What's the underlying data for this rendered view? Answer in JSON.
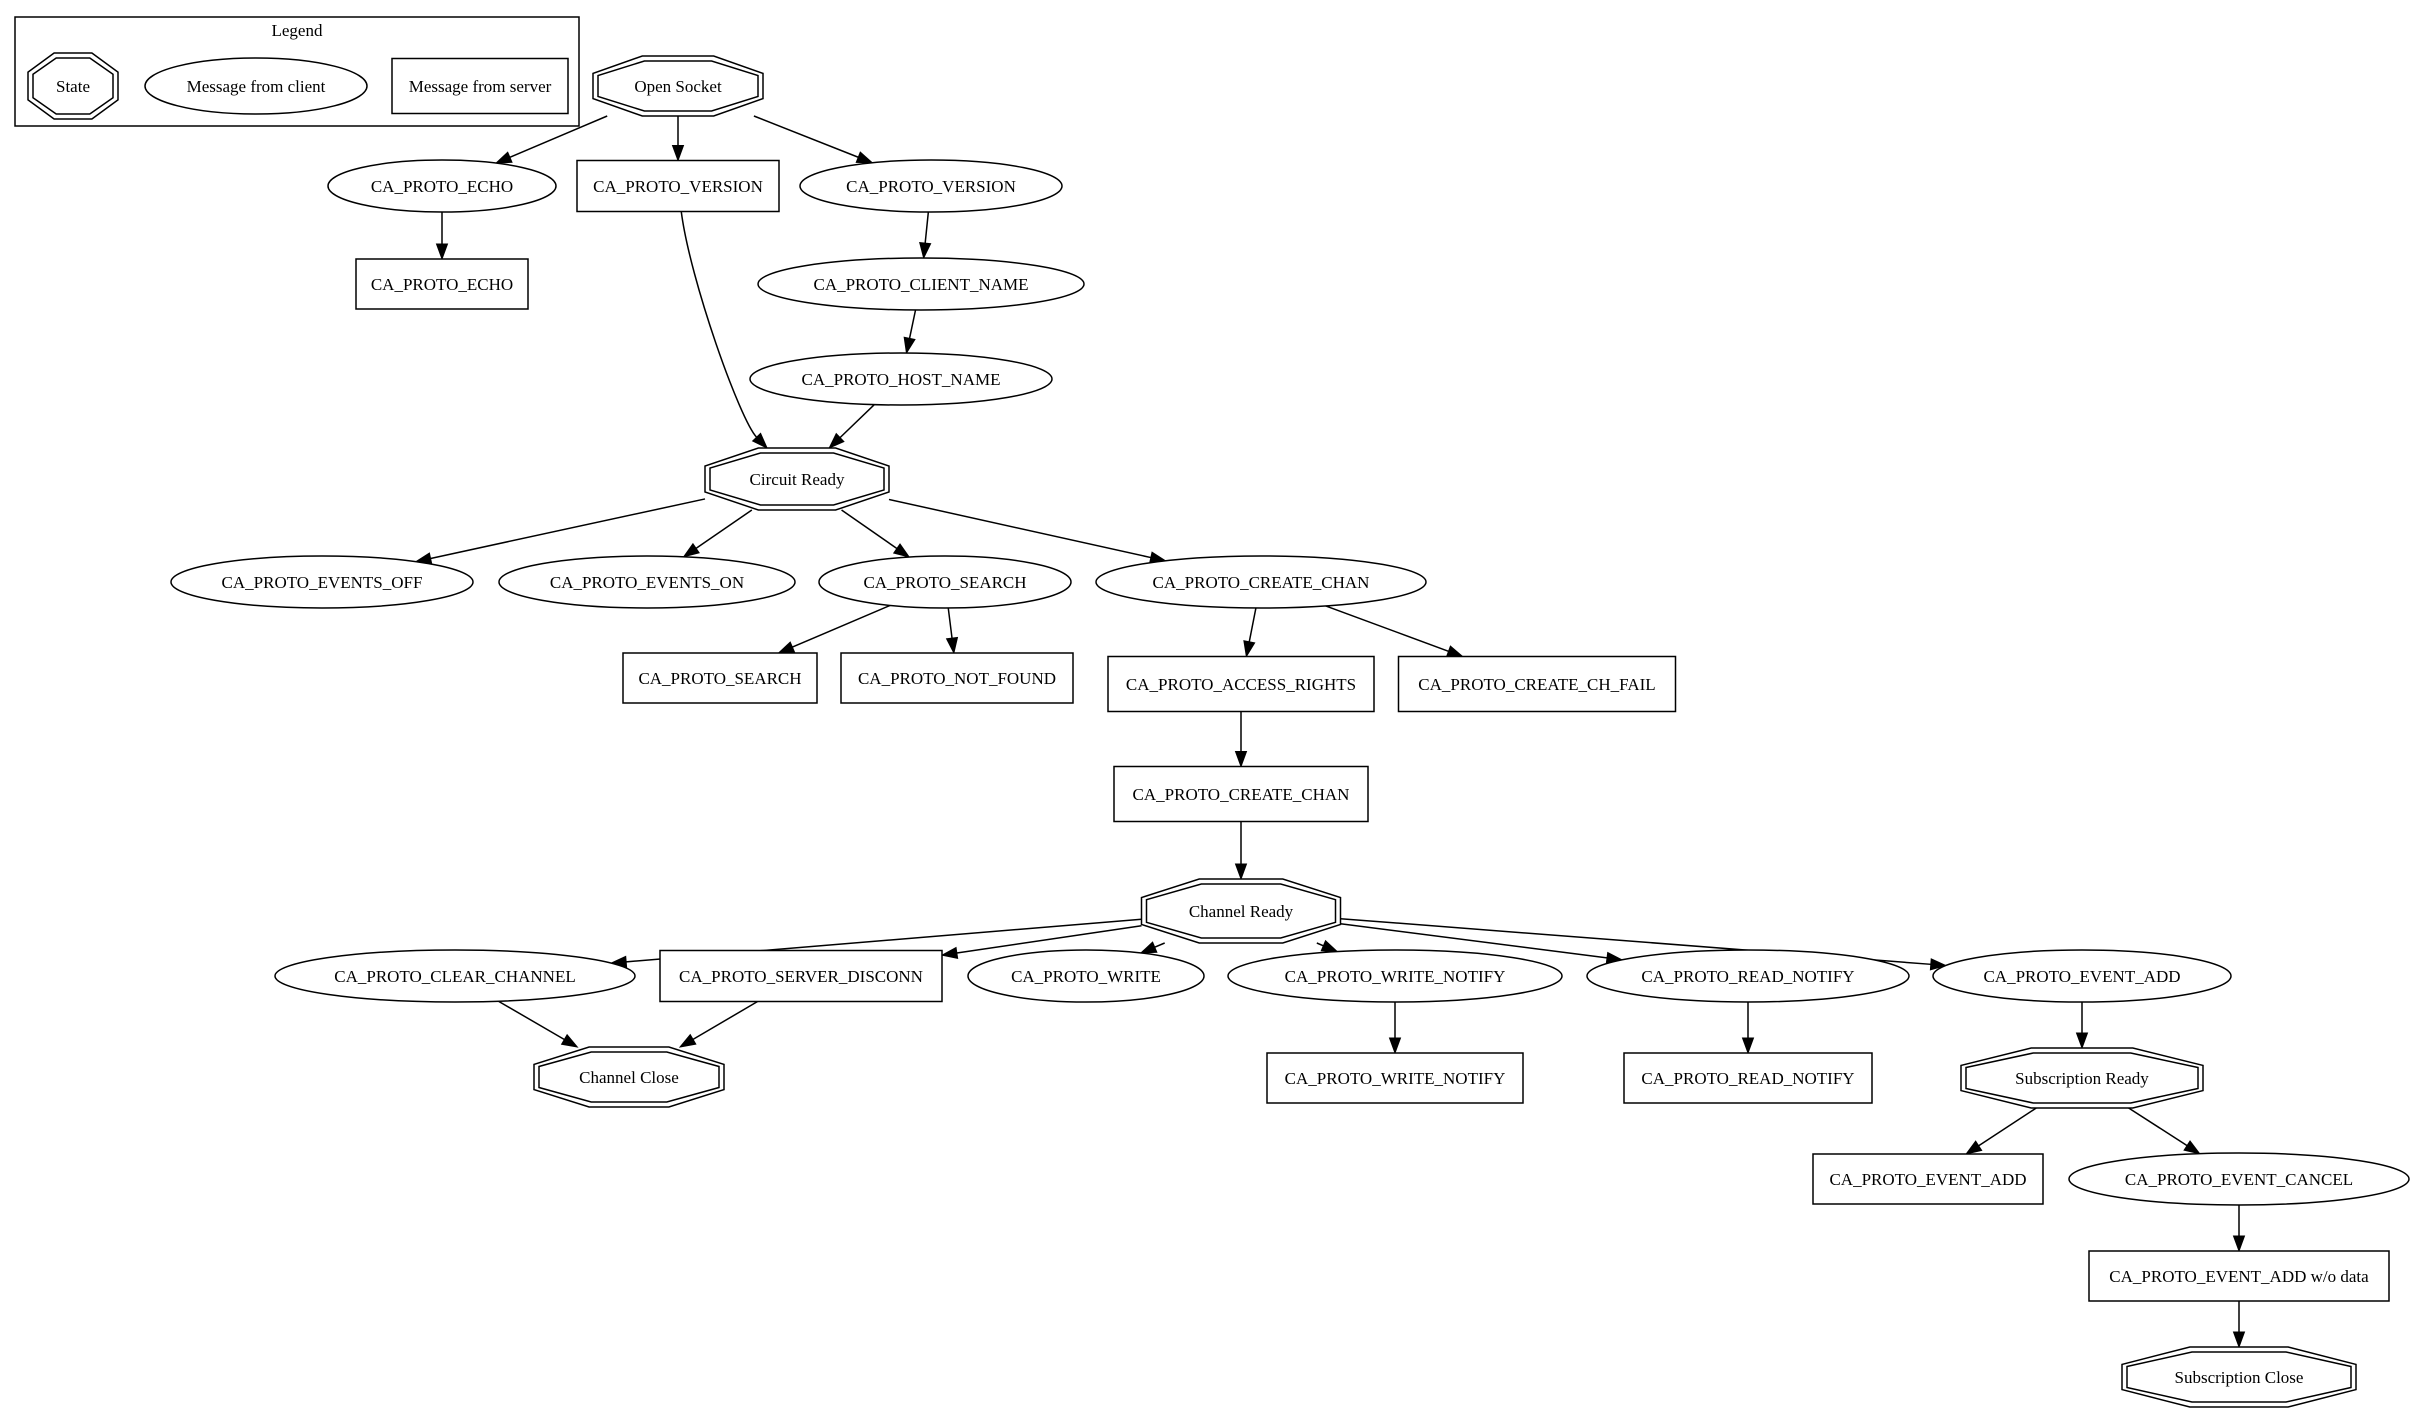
{
  "legend": {
    "title": "Legend",
    "items": [
      {
        "shape": "state",
        "label": "State"
      },
      {
        "shape": "client",
        "label": "Message from client"
      },
      {
        "shape": "server",
        "label": "Message from server"
      }
    ]
  },
  "nodes": {
    "open_socket": {
      "label": "Open Socket",
      "kind": "state"
    },
    "c_echo": {
      "label": "CA_PROTO_ECHO",
      "kind": "client"
    },
    "s_version": {
      "label": "CA_PROTO_VERSION",
      "kind": "server"
    },
    "c_version": {
      "label": "CA_PROTO_VERSION",
      "kind": "client"
    },
    "s_echo": {
      "label": "CA_PROTO_ECHO",
      "kind": "server"
    },
    "c_client_name": {
      "label": "CA_PROTO_CLIENT_NAME",
      "kind": "client"
    },
    "c_host_name": {
      "label": "CA_PROTO_HOST_NAME",
      "kind": "client"
    },
    "circuit_ready": {
      "label": "Circuit Ready",
      "kind": "state"
    },
    "c_events_off": {
      "label": "CA_PROTO_EVENTS_OFF",
      "kind": "client"
    },
    "c_events_on": {
      "label": "CA_PROTO_EVENTS_ON",
      "kind": "client"
    },
    "c_search": {
      "label": "CA_PROTO_SEARCH",
      "kind": "client"
    },
    "c_create_chan": {
      "label": "CA_PROTO_CREATE_CHAN",
      "kind": "client"
    },
    "s_search": {
      "label": "CA_PROTO_SEARCH",
      "kind": "server"
    },
    "s_not_found": {
      "label": "CA_PROTO_NOT_FOUND",
      "kind": "server"
    },
    "s_access_rights": {
      "label": "CA_PROTO_ACCESS_RIGHTS",
      "kind": "server"
    },
    "s_create_ch_fail": {
      "label": "CA_PROTO_CREATE_CH_FAIL",
      "kind": "server"
    },
    "s_create_chan": {
      "label": "CA_PROTO_CREATE_CHAN",
      "kind": "server"
    },
    "channel_ready": {
      "label": "Channel Ready",
      "kind": "state"
    },
    "c_clear_channel": {
      "label": "CA_PROTO_CLEAR_CHANNEL",
      "kind": "client"
    },
    "s_server_disconn": {
      "label": "CA_PROTO_SERVER_DISCONN",
      "kind": "server"
    },
    "c_write": {
      "label": "CA_PROTO_WRITE",
      "kind": "client"
    },
    "c_write_notify": {
      "label": "CA_PROTO_WRITE_NOTIFY",
      "kind": "client"
    },
    "c_read_notify": {
      "label": "CA_PROTO_READ_NOTIFY",
      "kind": "client"
    },
    "c_event_add": {
      "label": "CA_PROTO_EVENT_ADD",
      "kind": "client"
    },
    "channel_close": {
      "label": "Channel Close",
      "kind": "state"
    },
    "s_write_notify": {
      "label": "CA_PROTO_WRITE_NOTIFY",
      "kind": "server"
    },
    "s_read_notify": {
      "label": "CA_PROTO_READ_NOTIFY",
      "kind": "server"
    },
    "subscription_ready": {
      "label": "Subscription Ready",
      "kind": "state"
    },
    "s_event_add": {
      "label": "CA_PROTO_EVENT_ADD",
      "kind": "server"
    },
    "c_event_cancel": {
      "label": "CA_PROTO_EVENT_CANCEL",
      "kind": "client"
    },
    "s_event_add_nodata": {
      "label": "CA_PROTO_EVENT_ADD w/o data",
      "kind": "server"
    },
    "subscription_close": {
      "label": "Subscription Close",
      "kind": "state"
    }
  },
  "edges": [
    [
      "open_socket",
      "c_echo"
    ],
    [
      "open_socket",
      "s_version"
    ],
    [
      "open_socket",
      "c_version"
    ],
    [
      "c_echo",
      "s_echo"
    ],
    [
      "c_version",
      "c_client_name"
    ],
    [
      "c_client_name",
      "c_host_name"
    ],
    [
      "s_version",
      "circuit_ready"
    ],
    [
      "c_host_name",
      "circuit_ready"
    ],
    [
      "circuit_ready",
      "c_events_off"
    ],
    [
      "circuit_ready",
      "c_events_on"
    ],
    [
      "circuit_ready",
      "c_search"
    ],
    [
      "circuit_ready",
      "c_create_chan"
    ],
    [
      "c_search",
      "s_search"
    ],
    [
      "c_search",
      "s_not_found"
    ],
    [
      "c_create_chan",
      "s_access_rights"
    ],
    [
      "c_create_chan",
      "s_create_ch_fail"
    ],
    [
      "s_access_rights",
      "s_create_chan"
    ],
    [
      "s_create_chan",
      "channel_ready"
    ],
    [
      "channel_ready",
      "c_clear_channel"
    ],
    [
      "channel_ready",
      "s_server_disconn"
    ],
    [
      "channel_ready",
      "c_write"
    ],
    [
      "channel_ready",
      "c_write_notify"
    ],
    [
      "channel_ready",
      "c_read_notify"
    ],
    [
      "channel_ready",
      "c_event_add"
    ],
    [
      "c_clear_channel",
      "channel_close"
    ],
    [
      "s_server_disconn",
      "channel_close"
    ],
    [
      "c_write_notify",
      "s_write_notify"
    ],
    [
      "c_read_notify",
      "s_read_notify"
    ],
    [
      "c_event_add",
      "subscription_ready"
    ],
    [
      "subscription_ready",
      "s_event_add"
    ],
    [
      "subscription_ready",
      "c_event_cancel"
    ],
    [
      "c_event_cancel",
      "s_event_add_nodata"
    ],
    [
      "s_event_add_nodata",
      "subscription_close"
    ]
  ]
}
